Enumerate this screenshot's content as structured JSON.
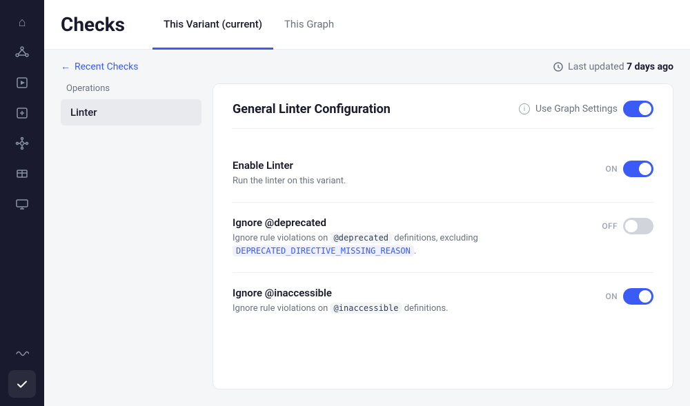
{
  "sidebar": {
    "icons": [
      {
        "name": "home-icon",
        "symbol": "⌂",
        "active": false
      },
      {
        "name": "graph-icon",
        "symbol": "⬡",
        "active": false
      },
      {
        "name": "play-icon",
        "symbol": "▷",
        "active": false
      },
      {
        "name": "plus-square-icon",
        "symbol": "⊞",
        "active": false
      },
      {
        "name": "hub-icon",
        "symbol": "❋",
        "active": false
      },
      {
        "name": "grid-icon",
        "symbol": "⊟",
        "active": false
      },
      {
        "name": "monitor-icon",
        "symbol": "▣",
        "active": false
      },
      {
        "name": "wave-icon",
        "symbol": "∿",
        "active": false
      }
    ],
    "check_label": "✓"
  },
  "header": {
    "title": "Checks",
    "tabs": [
      {
        "label": "This Variant (current)",
        "active": true
      },
      {
        "label": "This Graph",
        "active": false
      }
    ]
  },
  "breadcrumb": {
    "arrow": "←",
    "label": "Recent Checks",
    "last_updated_prefix": "Last updated",
    "last_updated_time": "7 days ago"
  },
  "left_nav": {
    "section_label": "Operations",
    "items": [
      {
        "label": "Linter",
        "active": true
      }
    ]
  },
  "right_panel": {
    "config_title": "General Linter Configuration",
    "use_graph_settings_label": "Use Graph Settings",
    "settings": [
      {
        "name": "Enable Linter",
        "desc_text": "Run the linter on this variant.",
        "desc_code": null,
        "status": "ON",
        "toggle_on": true
      },
      {
        "name": "Ignore @deprecated",
        "desc_prefix": "Ignore rule violations on ",
        "desc_code": "@deprecated",
        "desc_mid": " definitions, excluding",
        "desc_link": "DEPRECATED_DIRECTIVE_MISSING_REASON",
        "desc_suffix": ".",
        "status": "OFF",
        "toggle_on": false
      },
      {
        "name": "Ignore @inaccessible",
        "desc_prefix": "Ignore rule violations on ",
        "desc_code": "@inaccessible",
        "desc_mid": " definitions.",
        "desc_link": null,
        "desc_suffix": null,
        "status": "ON",
        "toggle_on": true
      }
    ]
  }
}
